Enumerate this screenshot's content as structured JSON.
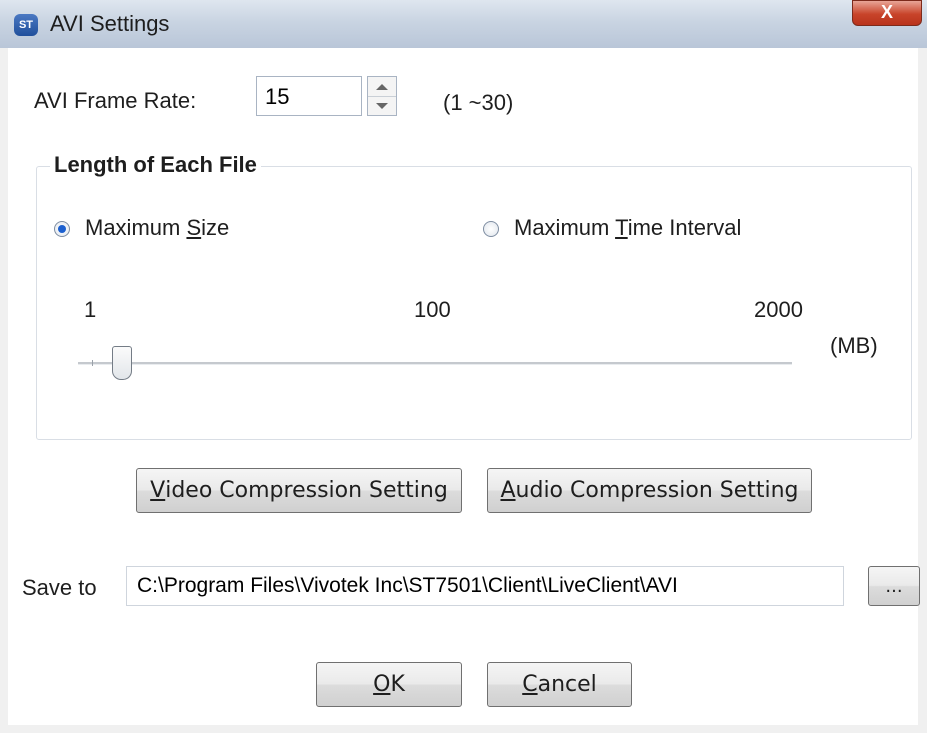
{
  "window": {
    "title": "AVI Settings",
    "title_icon_text": "ST",
    "close_glyph": "X"
  },
  "frame_rate": {
    "label": "AVI Frame Rate:",
    "value": "15",
    "range": "(1 ~30)"
  },
  "group": {
    "title": "Length of Each File",
    "option_size": {
      "pre": "Maximum ",
      "accel": "S",
      "post": "ize",
      "checked": true
    },
    "option_time": {
      "pre": "Maximum ",
      "accel": "T",
      "post": "ime Interval",
      "checked": false
    },
    "slider": {
      "min_label": "1",
      "mid_label": "100",
      "max_label": "2000",
      "unit": "(MB)",
      "value": 100
    }
  },
  "buttons": {
    "video": {
      "accel": "V",
      "rest": "ideo Compression Setting"
    },
    "audio": {
      "accel": "A",
      "rest": "udio Compression Setting"
    },
    "browse": "...",
    "ok": {
      "accel": "O",
      "rest": "K"
    },
    "cancel": {
      "accel": "C",
      "rest": "ancel"
    }
  },
  "save_to": {
    "label": "Save to",
    "path": "C:\\Program Files\\Vivotek Inc\\ST7501\\Client\\LiveClient\\AVI"
  }
}
